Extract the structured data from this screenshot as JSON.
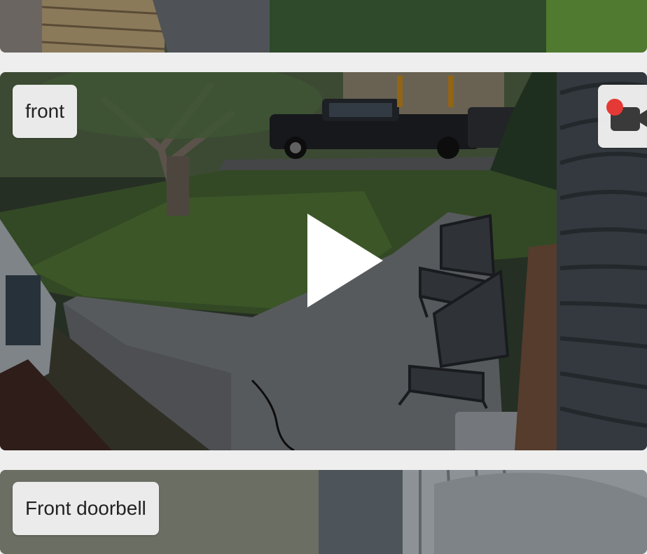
{
  "cameras": [
    {
      "label": "",
      "playable": false
    },
    {
      "label": "front",
      "playable": true,
      "recording": true
    },
    {
      "label": "Front doorbell",
      "playable": false
    }
  ],
  "colors": {
    "background": "#eeeeee",
    "chip_bg": "#f0f0f0",
    "record_dot": "#e53935",
    "play_icon": "#ffffff"
  },
  "icons": {
    "record": "video-camera-record-icon",
    "play": "play-icon"
  }
}
